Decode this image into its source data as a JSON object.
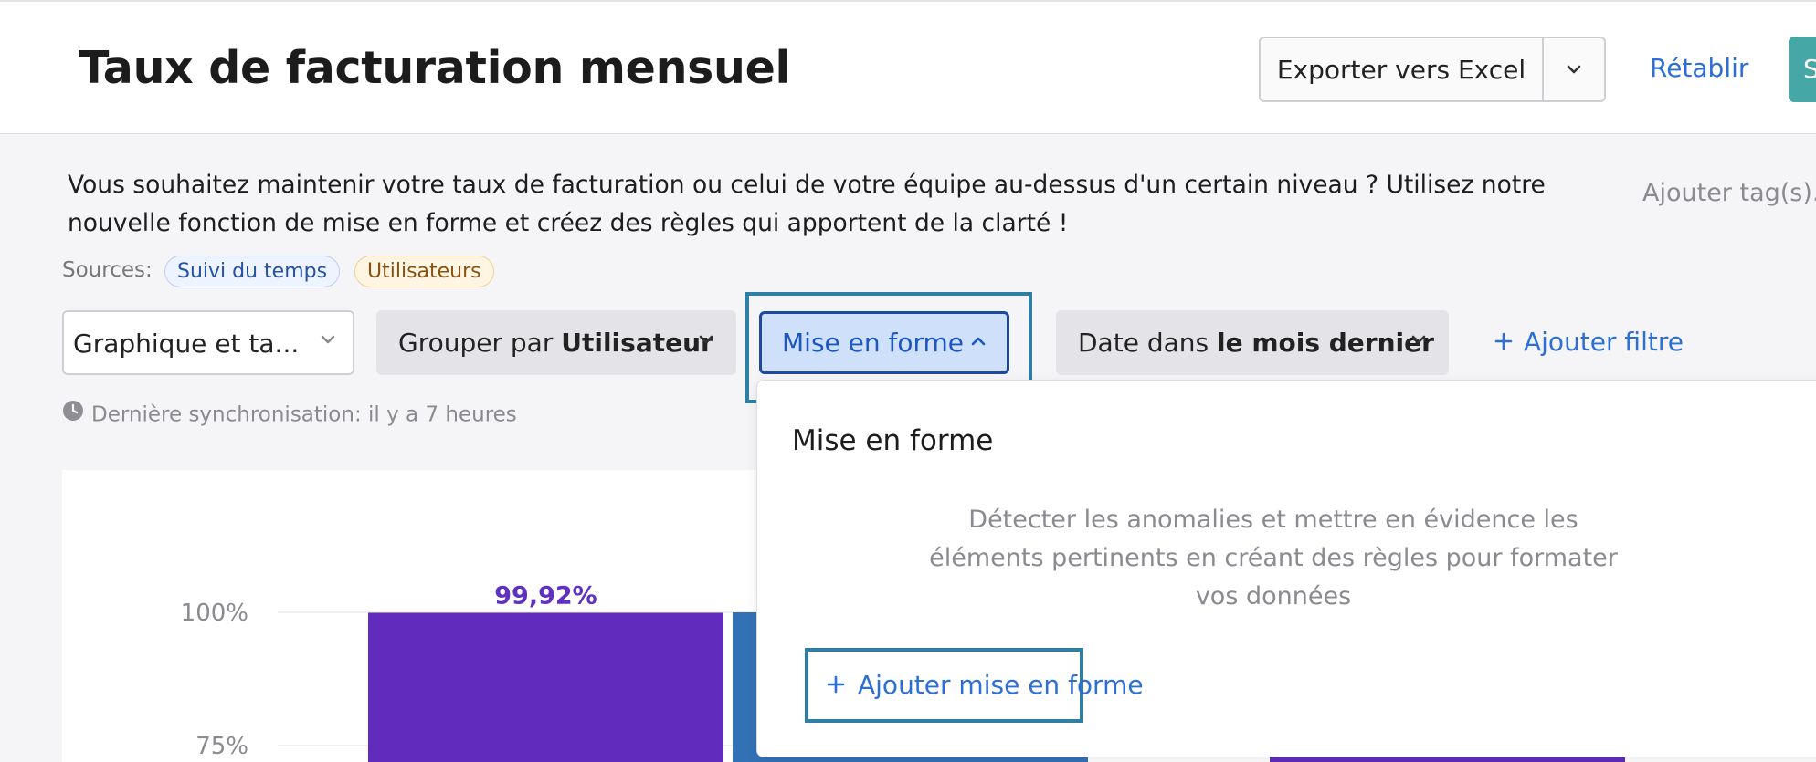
{
  "header": {
    "title": "Taux de facturation mensuel",
    "export_label": "Exporter vers Excel",
    "reset_label": "Rétablir",
    "save_label_partial": "S"
  },
  "description": {
    "text": "Vous souhaitez maintenir votre taux de facturation ou celui de votre équipe au-dessus d'un certain niveau ? Utilisez notre nouvelle fonction de mise en forme et créez des règles qui apportent de la clarté !",
    "add_tags": "Ajouter tag(s)."
  },
  "sources": {
    "label": "Sources:",
    "items": [
      {
        "label": "Suivi du temps",
        "color": "#2552a6"
      },
      {
        "label": "Utilisateurs",
        "color": "#8a5210"
      }
    ]
  },
  "toolbar": {
    "visualization": "Graphique et ta...",
    "group_prefix": "Grouper par ",
    "group_value": "Utilisateur",
    "format_label": "Mise en forme",
    "date_prefix": "Date dans ",
    "date_value": "le mois dernier",
    "add_filter": "Ajouter filtre"
  },
  "sync": {
    "text": "Dernière synchronisation: il y a 7 heures"
  },
  "format_panel": {
    "title": "Mise en forme",
    "description": "Détecter les anomalies et mettre en évidence les éléments pertinents en créant des règles pour formater vos données",
    "add_button": "Ajouter mise en forme"
  },
  "chart_data": {
    "type": "bar",
    "yticks": [
      "100%",
      "75%"
    ],
    "ylim": [
      0,
      100
    ],
    "values": [
      99.92,
      100,
      100
    ],
    "data_labels": [
      "99,92%"
    ],
    "colors": [
      "#612cbd",
      "#3371b6",
      "#612cbd"
    ]
  },
  "colors": {
    "accent": "#2c6fd6",
    "highlight": "#2e7fa3",
    "teal": "#45a8a6"
  }
}
